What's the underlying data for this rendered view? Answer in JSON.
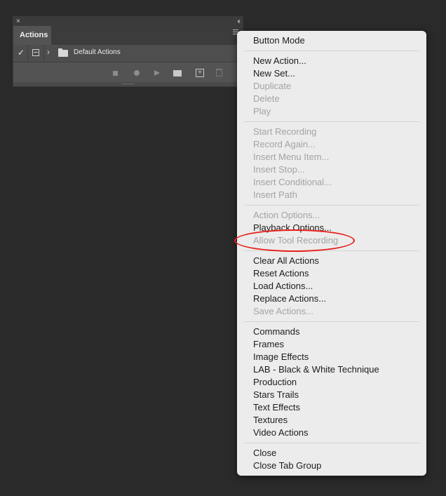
{
  "panel": {
    "close_glyph": "×",
    "collapse_glyph": "‹‹",
    "tab_label": "Actions",
    "row": {
      "check": "✓",
      "chevron": "›",
      "label": "Default Actions"
    },
    "toolbar": {
      "new_glyph": "+"
    }
  },
  "menu": {
    "groups": [
      [
        {
          "label": "Button Mode",
          "enabled": true
        }
      ],
      [
        {
          "label": "New Action...",
          "enabled": true
        },
        {
          "label": "New Set...",
          "enabled": true
        },
        {
          "label": "Duplicate",
          "enabled": false
        },
        {
          "label": "Delete",
          "enabled": false
        },
        {
          "label": "Play",
          "enabled": false
        }
      ],
      [
        {
          "label": "Start Recording",
          "enabled": false
        },
        {
          "label": "Record Again...",
          "enabled": false
        },
        {
          "label": "Insert Menu Item...",
          "enabled": false
        },
        {
          "label": "Insert Stop...",
          "enabled": false
        },
        {
          "label": "Insert Conditional...",
          "enabled": false
        },
        {
          "label": "Insert Path",
          "enabled": false
        }
      ],
      [
        {
          "label": "Action Options...",
          "enabled": false
        },
        {
          "label": "Playback Options...",
          "enabled": true
        },
        {
          "label": "Allow Tool Recording",
          "enabled": false
        }
      ],
      [
        {
          "label": "Clear All Actions",
          "enabled": true
        },
        {
          "label": "Reset Actions",
          "enabled": true
        },
        {
          "label": "Load Actions...",
          "enabled": true
        },
        {
          "label": "Replace Actions...",
          "enabled": true
        },
        {
          "label": "Save Actions...",
          "enabled": false
        }
      ],
      [
        {
          "label": "Commands",
          "enabled": true
        },
        {
          "label": "Frames",
          "enabled": true
        },
        {
          "label": "Image Effects",
          "enabled": true
        },
        {
          "label": "LAB - Black & White Technique",
          "enabled": true
        },
        {
          "label": "Production",
          "enabled": true
        },
        {
          "label": "Stars Trails",
          "enabled": true
        },
        {
          "label": "Text Effects",
          "enabled": true
        },
        {
          "label": "Textures",
          "enabled": true
        },
        {
          "label": "Video Actions",
          "enabled": true
        }
      ],
      [
        {
          "label": "Close",
          "enabled": true
        },
        {
          "label": "Close Tab Group",
          "enabled": true
        }
      ]
    ]
  },
  "colors": {
    "background": "#2a2a2a",
    "menu_background": "#ececec",
    "menu_text_enabled": "#1c1c1c",
    "menu_text_disabled": "#a3a3a3",
    "highlight_ellipse": "#e8201a"
  },
  "icons": [
    "close-icon",
    "collapse-icon",
    "panel-menu-icon",
    "checkmark-icon",
    "dialog-toggle-icon",
    "chevron-right-icon",
    "folder-icon",
    "stop-icon",
    "record-icon",
    "play-icon",
    "new-set-icon",
    "new-action-icon",
    "trash-icon"
  ]
}
